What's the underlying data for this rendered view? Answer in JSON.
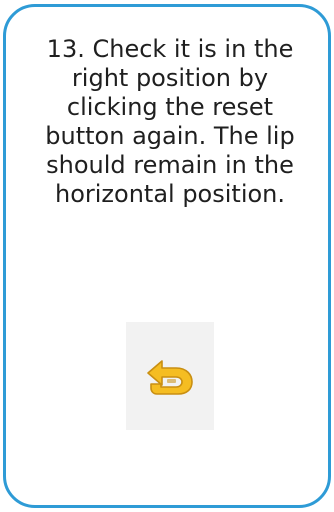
{
  "instruction": {
    "text": "13. Check it is in the right position by clicking the reset button again. The lip should remain in the horizontal position."
  },
  "reset_button": {
    "icon": "reset-arrow-icon",
    "color": "#f5bd22",
    "outline_color": "#c98f12",
    "tile_color": "#f2f2f2"
  },
  "card": {
    "border_color": "#2e9bd6"
  }
}
